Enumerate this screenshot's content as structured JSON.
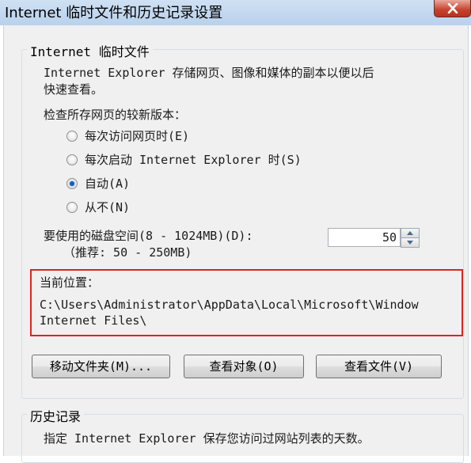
{
  "window": {
    "title": "Internet 临时文件和历史记录设置",
    "close_icon": "close-icon"
  },
  "temp_files": {
    "group_title": "Internet 临时文件",
    "description_line1": "Internet Explorer 存储网页、图像和媒体的副本以便以后",
    "description_line2": "快速查看。",
    "check_label": "检查所存网页的较新版本：",
    "options": [
      {
        "label": "每次访问网页时(E)",
        "checked": false
      },
      {
        "label": "每次启动 Internet Explorer 时(S)",
        "checked": false
      },
      {
        "label": "自动(A)",
        "checked": true
      },
      {
        "label": "从不(N)",
        "checked": false
      }
    ],
    "disk_space_label": "要使用的磁盘空间(8 - 1024MB)(D):",
    "disk_space_hint": "（推荐: 50 - 250MB)",
    "disk_space_value": "50",
    "location_label": "当前位置：",
    "location_path_line1": "C:\\Users\\Administrator\\AppData\\Local\\Microsoft\\Window",
    "location_path_line2": "Internet Files\\",
    "highlight_color": "#e0231f",
    "buttons": {
      "move_folder": "移动文件夹(M)...",
      "view_objects": "查看对象(O)",
      "view_files": "查看文件(V)"
    }
  },
  "history": {
    "group_title": "历史记录",
    "description": "指定 Internet Explorer 保存您访问过网站列表的天数。"
  }
}
